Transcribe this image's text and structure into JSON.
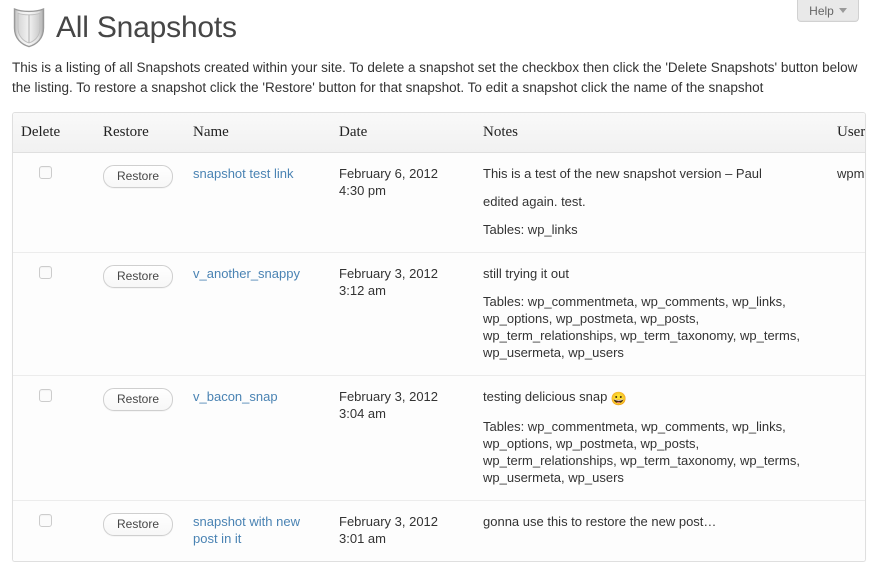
{
  "help": {
    "label": "Help",
    "icon": "chevron-down-icon"
  },
  "header": {
    "title": "All Snapshots",
    "icon": "shield-icon"
  },
  "intro": "This is a listing of all Snapshots created within your site. To delete a snapshot set the checkbox then click the 'Delete Snapshots' button below the listing. To restore a snapshot click the 'Restore' button for that snapshot. To edit a snapshot click the name of the snapshot",
  "table": {
    "columns": [
      "Delete",
      "Restore",
      "Name",
      "Date",
      "Notes",
      "User"
    ],
    "restore_button_label": "Restore",
    "rows": [
      {
        "name": "snapshot test link",
        "date_line1": "February 6, 2012",
        "date_line2": "4:30 pm",
        "note1": "This is a test of the new snapshot version – Paul",
        "note2": "edited again. test.",
        "tables": "Tables: wp_links",
        "emoji": "",
        "user": "wpmudev_admin"
      },
      {
        "name": "v_another_snappy",
        "date_line1": "February 3, 2012",
        "date_line2": "3:12 am",
        "note1": "still trying it out",
        "note2": "",
        "tables": "Tables: wp_commentmeta, wp_comments, wp_links, wp_options, wp_postmeta, wp_posts, wp_term_relationships, wp_term_taxonomy, wp_terms, wp_usermeta, wp_users",
        "emoji": "",
        "user": ""
      },
      {
        "name": "v_bacon_snap",
        "date_line1": "February 3, 2012",
        "date_line2": "3:04 am",
        "note1": "testing delicious snap ",
        "note2": "",
        "tables": "Tables: wp_commentmeta, wp_comments, wp_links, wp_options, wp_postmeta, wp_posts, wp_term_relationships, wp_term_taxonomy, wp_terms, wp_usermeta, wp_users",
        "emoji": "😀",
        "user": ""
      },
      {
        "name": "snapshot with new post in it",
        "date_line1": "February 3, 2012",
        "date_line2": "3:01 am",
        "note1": "gonna use this to restore the new post…",
        "note2": "",
        "tables": "",
        "emoji": "",
        "user": ""
      }
    ]
  },
  "colors": {
    "link": "#4a83b3",
    "text": "#333333",
    "title": "#464646",
    "border": "#dfdfdf"
  }
}
